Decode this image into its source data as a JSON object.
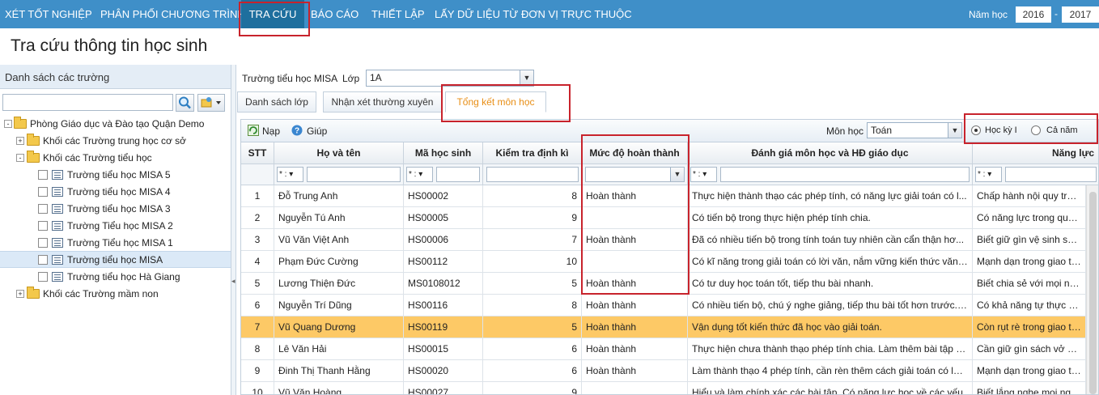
{
  "nav": {
    "items": [
      "XÉT TỐT NGHIỆP",
      "PHÂN PHỐI CHƯƠNG TRÌNH",
      "TRA CỨU",
      "BÁO CÁO",
      "THIẾT LẬP",
      "LẤY DỮ LIỆU TỪ ĐƠN VỊ TRỰC THUỘC"
    ],
    "active": "TRA CỨU",
    "year_label": "Năm học",
    "year_from": "2016",
    "year_sep": "-",
    "year_to": "2017"
  },
  "page_title": "Tra cứu thông tin học sinh",
  "left": {
    "header": "Danh sách các trường",
    "search_placeholder": "",
    "tree": [
      {
        "label": "Phòng Giáo dục và Đào tạo Quận Demo",
        "level": 0,
        "type": "folder",
        "expander": "-"
      },
      {
        "label": "Khối các Trường trung học cơ sở",
        "level": 1,
        "type": "folder",
        "expander": "+"
      },
      {
        "label": "Khối các Trường tiểu học",
        "level": 1,
        "type": "folder",
        "expander": "-"
      },
      {
        "label": "Trường tiểu học MISA 5",
        "level": 2,
        "type": "school"
      },
      {
        "label": "Trường tiểu học MISA 4",
        "level": 2,
        "type": "school"
      },
      {
        "label": "Trường tiểu học MISA 3",
        "level": 2,
        "type": "school"
      },
      {
        "label": "Trường Tiểu học MISA 2",
        "level": 2,
        "type": "school"
      },
      {
        "label": "Trường Tiểu học MISA 1",
        "level": 2,
        "type": "school"
      },
      {
        "label": "Trường tiểu học MISA",
        "level": 2,
        "type": "school",
        "selected": true
      },
      {
        "label": "Trường tiểu học Hà Giang",
        "level": 2,
        "type": "school"
      },
      {
        "label": "Khối các Trường mầm non",
        "level": 1,
        "type": "folder",
        "expander": "+"
      }
    ]
  },
  "right": {
    "school_name": "Trường tiểu học MISA",
    "class_label": "Lớp",
    "class_value": "1A",
    "tabs": [
      "Danh sách lớp",
      "Nhận xét thường xuyên",
      "Tổng kết môn học"
    ],
    "active_tab": "Tổng kết môn học",
    "toolbar": {
      "reload": "Nạp",
      "help": "Giúp",
      "subject_label": "Môn học",
      "subject_value": "Toán",
      "radio_1": "Học kỳ I",
      "radio_2": "Cả năm",
      "selected_radio": "Học kỳ I"
    },
    "filter_op": "* :",
    "columns": [
      "STT",
      "Họ và tên",
      "Mã học sinh",
      "Kiểm tra định kì",
      "Mức độ hoàn thành",
      "Đánh giá môn học và HĐ giáo dục",
      "Năng lực"
    ],
    "rows": [
      {
        "stt": "1",
        "name": "Đỗ Trung Anh",
        "code": "HS00002",
        "score": "8",
        "level": "Hoàn thành",
        "eval": "Thực hiện thành thạo các phép tính, có năng lực giải toán có l...",
        "ability": "Chấp hành nội quy trườn"
      },
      {
        "stt": "2",
        "name": "Nguyễn Tú Anh",
        "code": "HS00005",
        "score": "9",
        "level": "",
        "eval": "Có tiến bộ trong thực hiện phép tính chia.",
        "ability": "Có năng lực trong quản lý"
      },
      {
        "stt": "3",
        "name": "Vũ Văn Việt Anh",
        "code": "HS00006",
        "score": "7",
        "level": "Hoàn thành",
        "eval": "Đã có nhiều tiến bộ trong tính toán tuy nhiên cần cẩn thận hơ...",
        "ability": "Biết giữ gìn vệ sinh sạch s"
      },
      {
        "stt": "4",
        "name": "Phạm Đức Cường",
        "code": "HS00112",
        "score": "10",
        "level": "",
        "eval": "Có kĩ năng trong giải toán có lời văn, nắm vững kiến thức văn ...",
        "ability": "Mạnh dạn trong giao tiếp"
      },
      {
        "stt": "5",
        "name": "Lương Thiện Đức",
        "code": "MS0108012",
        "score": "5",
        "level": "Hoàn thành",
        "eval": "Có tư duy học toán tốt, tiếp thu bài nhanh.",
        "ability": "Biết chia sẻ với mọi người"
      },
      {
        "stt": "6",
        "name": "Nguyễn Trí Dũng",
        "code": "HS00116",
        "score": "8",
        "level": "Hoàn thành",
        "eval": "Có nhiều tiến bộ, chú ý nghe giảng, tiếp thu bài tốt hơn trước. ...",
        "ability": "Có khả năng tự thực hiện"
      },
      {
        "stt": "7",
        "name": "Vũ Quang Dương",
        "code": "HS00119",
        "score": "5",
        "level": "Hoàn thành",
        "eval": "Vận dụng tốt kiến thức đã học vào giải toán.",
        "ability": "Còn rụt rè trong giao tiếp",
        "highlight": true
      },
      {
        "stt": "8",
        "name": "Lê Văn Hải",
        "code": "HS00015",
        "score": "6",
        "level": "Hoàn thành",
        "eval": "Thực hiện chưa thành thạo phép tính chia. Làm thêm bài tập v...",
        "ability": "Cần giữ gìn sách vở cẩn t"
      },
      {
        "stt": "9",
        "name": "Đinh Thị Thanh Hằng",
        "code": "HS00020",
        "score": "6",
        "level": "Hoàn thành",
        "eval": "Làm thành thạo 4 phép tính, cần rèn thêm cách giải toán có lời...",
        "ability": "Mạnh dạn trong giao tiếp"
      },
      {
        "stt": "10",
        "name": "Vũ Văn Hoàng",
        "code": "HS00027",
        "score": "9",
        "level": "",
        "eval": "Hiểu và làm chính xác các bài tập. Có năng lực học về các yếu",
        "ability": "Biết lắng nghe mọi người"
      }
    ]
  }
}
